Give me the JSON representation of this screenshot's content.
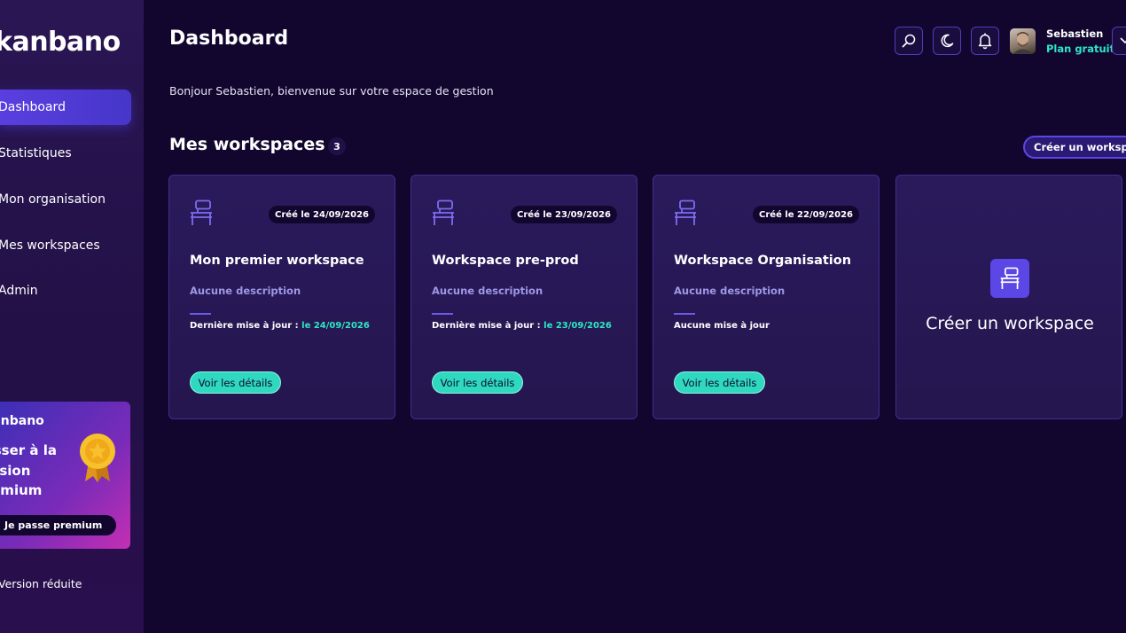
{
  "app": {
    "logo": "kanbano"
  },
  "sidebar": {
    "items": [
      {
        "label": "Dashboard"
      },
      {
        "label": "Statistiques"
      },
      {
        "label": "Mon organisation"
      },
      {
        "label": "Mes workspaces"
      },
      {
        "label": "Admin"
      }
    ],
    "premium": {
      "brand": "kanbano",
      "title": "Passer à la version premium",
      "button": "Je passe premium"
    },
    "version_label": "Version réduite"
  },
  "header": {
    "title": "Dashboard",
    "welcome": "Bonjour Sebastien, bienvenue sur votre espace de gestion",
    "user": {
      "name": "Sebastien",
      "plan": "Plan gratuit"
    },
    "icons": [
      "search-icon",
      "moon-icon",
      "bell-icon",
      "chevron-down-icon"
    ]
  },
  "workspaces": {
    "title": "Mes workspaces",
    "count": "3",
    "create_button": "Créer un workspace",
    "cards": [
      {
        "created": "Créé le 24/09/2026",
        "title": "Mon premier workspace",
        "description": "Aucune description",
        "update_label": "Dernière mise à jour : ",
        "update_date": "le 24/09/2026",
        "button": "Voir les détails"
      },
      {
        "created": "Créé le 23/09/2026",
        "title": "Workspace pre-prod",
        "description": "Aucune description",
        "update_label": "Dernière mise à jour : ",
        "update_date": "le 23/09/2026",
        "button": "Voir les détails"
      },
      {
        "created": "Créé le 22/09/2026",
        "title": "Workspace Organisation",
        "description": "Aucune description",
        "update_label": "Aucune mise à jour",
        "update_date": "",
        "button": "Voir les détails"
      }
    ],
    "create_card_label": "Créer un workspace"
  },
  "colors": {
    "accent": "#5b46e6",
    "teal": "#2ee6c6",
    "background": "#12062f"
  }
}
